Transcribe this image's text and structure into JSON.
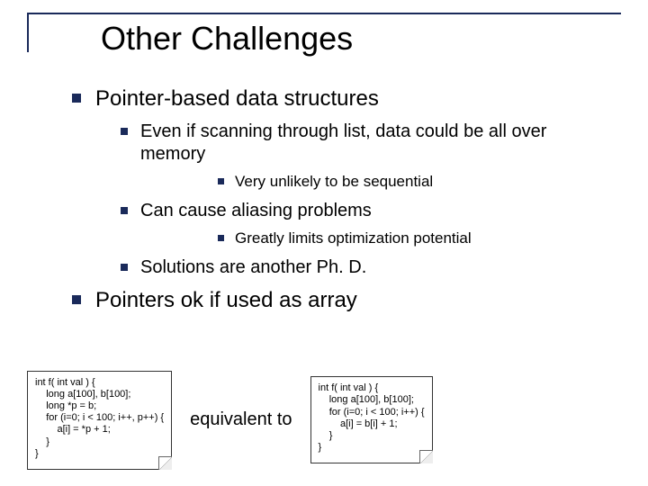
{
  "title": "Other Challenges",
  "bullets": {
    "l1a": "Pointer-based data structures",
    "l2a": "Even if scanning through list, data could be all over memory",
    "l3a": "Very unlikely to be sequential",
    "l2b": "Can cause aliasing problems",
    "l3b": "Greatly limits optimization potential",
    "l2c": "Solutions are another Ph. D.",
    "l1b": "Pointers ok if used as array"
  },
  "code_left": "int f( int val ) {\n    long a[100], b[100];\n    long *p = b;\n    for (i=0; i < 100; i++, p++) {\n        a[i] = *p + 1;\n    }\n}",
  "equiv": "equivalent to",
  "code_right": "int f( int val ) {\n    long a[100], b[100];\n    for (i=0; i < 100; i++) {\n        a[i] = b[i] + 1;\n    }\n}"
}
